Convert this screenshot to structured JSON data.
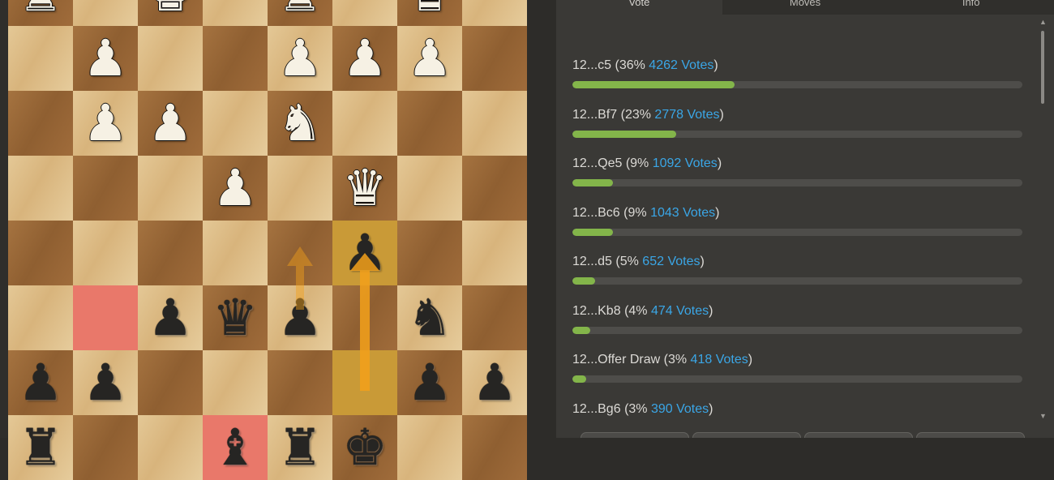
{
  "tabs": [
    {
      "label": "Vote",
      "active": true
    },
    {
      "label": "Moves",
      "active": false
    },
    {
      "label": "Info",
      "active": false
    }
  ],
  "votes": [
    {
      "move": "12...c5",
      "percent_label": "(36%",
      "votes_label": "4262 Votes",
      "close": ")",
      "share": 0.36
    },
    {
      "move": "12...Bf7",
      "percent_label": "(23%",
      "votes_label": "2778 Votes",
      "close": ")",
      "share": 0.23
    },
    {
      "move": "12...Qe5",
      "percent_label": "(9%",
      "votes_label": "1092 Votes",
      "close": ")",
      "share": 0.09
    },
    {
      "move": "12...Bc6",
      "percent_label": "(9%",
      "votes_label": "1043 Votes",
      "close": ")",
      "share": 0.09
    },
    {
      "move": "12...d5",
      "percent_label": "(5%",
      "votes_label": "652 Votes",
      "close": ")",
      "share": 0.05
    },
    {
      "move": "12...Kb8",
      "percent_label": "(4%",
      "votes_label": "474 Votes",
      "close": ")",
      "share": 0.04
    },
    {
      "move": "12...Offer Draw",
      "percent_label": "(3%",
      "votes_label": "418 Votes",
      "close": ")",
      "share": 0.03
    },
    {
      "move": "12...Bg6",
      "percent_label": "(3%",
      "votes_label": "390 Votes",
      "close": ")",
      "share": 0.03
    }
  ],
  "board": {
    "pieces": {
      "a8": "wR",
      "c8": "wK",
      "e8": "wR",
      "g8": "wQ",
      "b7": "wP",
      "e7": "wP",
      "f7": "wP",
      "g7": "wP",
      "b6": "wP",
      "c6": "wP",
      "e6": "wN",
      "d5": "wP",
      "f5": "wQ",
      "f4": "bP",
      "c3": "bP",
      "d3": "bQ",
      "e3": "bP",
      "g3": "bN",
      "a2": "bP",
      "b2": "bP",
      "g2": "bP",
      "h2": "bP",
      "a1": "bR",
      "d1": "bB",
      "e1": "bR",
      "f1": "bK"
    },
    "last_move_squares": [
      "f4",
      "f2"
    ],
    "red_squares": [
      "b3",
      "d1"
    ],
    "arrows": [
      {
        "from": "f2",
        "to": "f4",
        "style": "strong"
      },
      {
        "from": "e3",
        "to": "e4",
        "style": "faint"
      }
    ],
    "colors": {
      "arrow": "#f4a11a",
      "vote_bar": "#83b54a",
      "votes_link": "#3aa6e6",
      "red_highlight": "#e9786a"
    }
  }
}
